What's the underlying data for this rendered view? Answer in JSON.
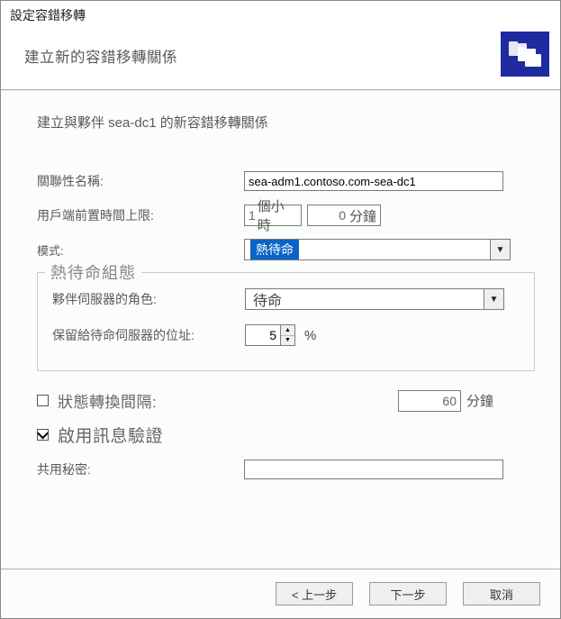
{
  "dialog": {
    "title": "設定容錯移轉",
    "subtitle": "建立新的容錯移轉關係",
    "intro": "建立與夥伴 sea-dc1 的新容錯移轉關係"
  },
  "fields": {
    "relationship_name_label": "關聯性名稱:",
    "relationship_name_value": "sea-adm1.contoso.com-sea-dc1",
    "mclt_label": "用戶端前置時間上限:",
    "mclt_hours_value": "1",
    "mclt_hours_unit": "個小時",
    "mclt_minutes_value": "0",
    "mclt_minutes_unit": "分鐘",
    "mode_label": "模式:",
    "mode_value": "熱待命"
  },
  "group": {
    "legend": "熱待命組態",
    "partner_role_label": "夥伴伺服器的角色:",
    "partner_role_value": "待命",
    "reserve_label": "保留給待命伺服器的位址:",
    "reserve_value": "5",
    "reserve_unit": "%"
  },
  "options": {
    "state_switch_label": "狀態轉換間隔:",
    "state_switch_checked": false,
    "state_switch_value": "60",
    "state_switch_unit": "分鐘",
    "msg_auth_label": "啟用訊息驗證",
    "msg_auth_checked": true,
    "shared_secret_label": "共用秘密:",
    "shared_secret_value": ""
  },
  "buttons": {
    "back": "< 上一步",
    "next": "下一步",
    "cancel": "取消"
  },
  "icons": {
    "header_icon": "folders-icon",
    "dropdown_arrow": "▼",
    "spin_up": "▲",
    "spin_down": "▼"
  }
}
